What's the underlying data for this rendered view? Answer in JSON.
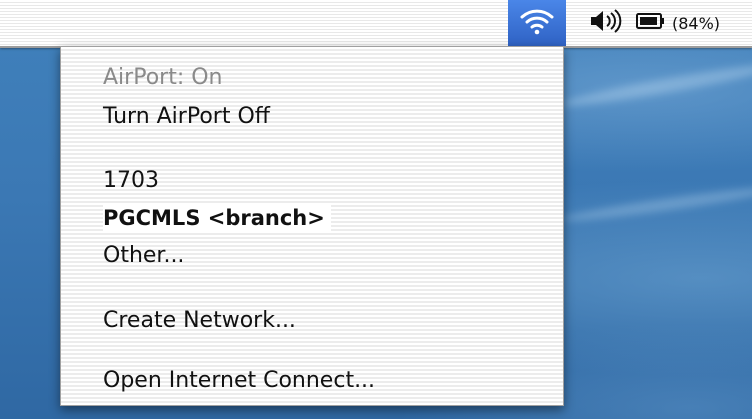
{
  "menubar": {
    "extras": {
      "airport_icon": "wifi-icon",
      "volume_icon": "speaker-volume-icon",
      "battery_icon": "battery-icon",
      "battery_percent": "(84%)"
    },
    "colors": {
      "airport_highlight": "#3c73d6"
    }
  },
  "airport_menu": {
    "status": "AirPort: On",
    "toggle_label": "Turn AirPort Off",
    "networks": [
      {
        "name": "1703",
        "selected": false
      },
      {
        "name": "PGCMLS <branch>",
        "selected": true
      }
    ],
    "other_label": "Other...",
    "create_network_label": "Create Network...",
    "open_internet_connect_label": "Open Internet Connect..."
  }
}
